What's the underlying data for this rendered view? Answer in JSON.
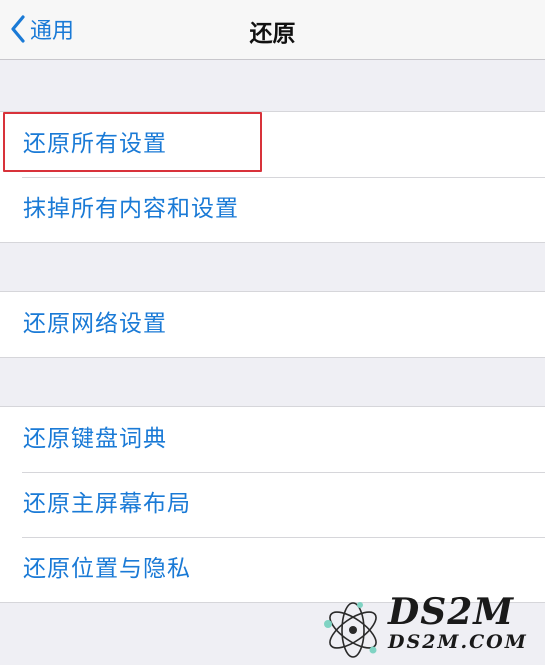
{
  "nav": {
    "back_label": "通用",
    "title": "还原"
  },
  "groups": [
    {
      "items": [
        {
          "label": "还原所有设置"
        },
        {
          "label": "抹掉所有内容和设置"
        }
      ]
    },
    {
      "items": [
        {
          "label": "还原网络设置"
        }
      ]
    },
    {
      "items": [
        {
          "label": "还原键盘词典"
        },
        {
          "label": "还原主屏幕布局"
        },
        {
          "label": "还原位置与隐私"
        }
      ]
    }
  ],
  "watermark": {
    "brand": "DS2M",
    "domain": "DS2M.COM"
  },
  "colors": {
    "accent": "#1a7ad6",
    "highlight_box": "#d8323a",
    "background": "#efeff4"
  },
  "icons": {
    "back": "chevron-left-icon"
  }
}
